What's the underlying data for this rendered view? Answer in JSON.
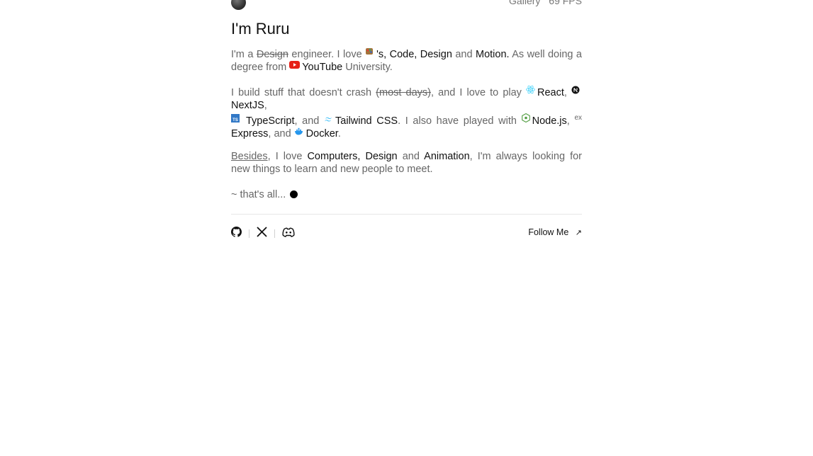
{
  "header": {
    "gallery": "Gallery",
    "fps": "69 FPS"
  },
  "title": "I'm Ruru",
  "para1": {
    "t1": "I'm a ",
    "design_strike": "Design",
    "t2": " engineer. I love ",
    "t3": "'s, ",
    "code": "Code,",
    "design": "Design",
    "t4": " and ",
    "motion": "Motion.",
    "t5": " As well doing a degree from ",
    "youtube": "YouTube",
    "t6": " University."
  },
  "para2": {
    "t1": "I build stuff that doesn't crash ",
    "most_days": "(most days)",
    "t2": ", and I love to play ",
    "react": "React",
    "comma1": ", ",
    "nextjs": "NextJS",
    "comma2": ",",
    "typescript": "TypeScript",
    "t3": ", and ",
    "tailwind": "Tailwind CSS",
    "t4": ". I also have played with ",
    "node": "Node.js",
    "comma3": ", ",
    "ex": "ex",
    "express": "Express",
    "t5": ", and ",
    "docker": "Docker",
    "t6": "."
  },
  "para3": {
    "besides": "Besides",
    "t1": ", I love ",
    "computers": "Computers,",
    "design": "Design",
    "t2": " and ",
    "animation": "Animation",
    "t3": ", I'm always looking for new things to learn and new people to meet."
  },
  "closing": "~ that's all...",
  "footer": {
    "follow": "Follow Me",
    "follow_arrow": "↗"
  },
  "icons": [
    "github-icon",
    "x-icon",
    "discord-icon"
  ]
}
